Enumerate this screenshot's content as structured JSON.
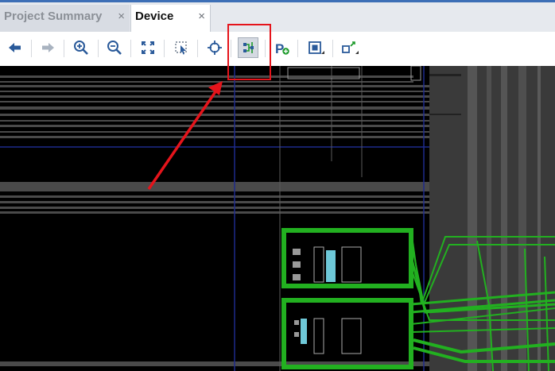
{
  "tabs": [
    {
      "label": "Project Summary",
      "close": "×",
      "active": false
    },
    {
      "label": "Device",
      "close": "×",
      "active": true
    }
  ],
  "toolbar": {
    "buttons": [
      {
        "name": "back-button",
        "icon": "arrow-left-icon"
      },
      {
        "name": "forward-button",
        "icon": "arrow-right-icon",
        "disabled": true
      },
      {
        "name": "zoom-in-button",
        "icon": "zoom-in-icon"
      },
      {
        "name": "zoom-out-button",
        "icon": "zoom-out-icon"
      },
      {
        "name": "zoom-fit-button",
        "icon": "fit-icon"
      },
      {
        "name": "zoom-selected-button",
        "icon": "zoom-selected-icon"
      },
      {
        "name": "autofit-selection-button",
        "icon": "crosshair-icon"
      },
      {
        "name": "routing-resources-button",
        "icon": "routing-resources-icon",
        "pressed": true
      },
      {
        "name": "create-pblock-button",
        "icon": "pblock-icon"
      },
      {
        "name": "draw-pblock-button",
        "icon": "region-icon"
      },
      {
        "name": "cell-menu-button",
        "icon": "cell-icon"
      }
    ]
  },
  "annotation": {
    "highlight_color": "#e5141b"
  },
  "colors": {
    "canvas_bg": "#000000",
    "routing_green": "#22b020",
    "tile_gray": "#4a4a4a",
    "clock_region_line": "#1e2a8c",
    "accent_blue": "#3d6fb6"
  }
}
